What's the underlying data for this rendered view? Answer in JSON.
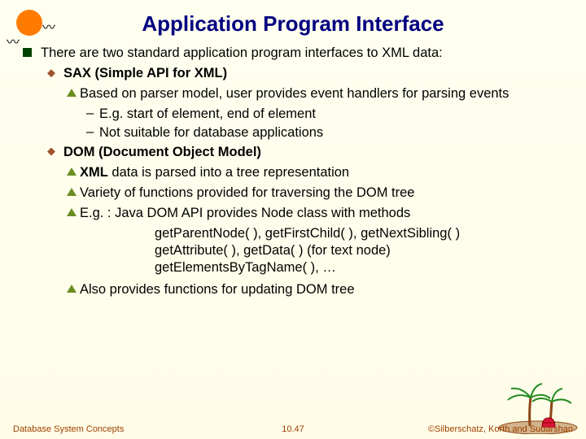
{
  "title": "Application Program Interface",
  "l1_intro": "There are two standard application program interfaces to XML data:",
  "sax": {
    "heading": "SAX (Simple API for XML)",
    "detail": "Based on parser model, user provides event handlers for parsing events",
    "sub1": "E.g. start of element, end of element",
    "sub2": "Not suitable for database applications"
  },
  "dom": {
    "heading": "DOM (Document Object Model)",
    "d1_bold": "XML",
    "d1_rest": " data is parsed into a tree representation",
    "d2": "Variety of functions provided for traversing the DOM tree",
    "d3": "E.g. :  Java DOM API provides Node class with methods",
    "d3a": "getParentNode( ), getFirstChild( ), getNextSibling( )",
    "d3b": "getAttribute( ), getData( ) (for text node)",
    "d3c": "getElementsByTagName( ), …",
    "d4": "Also provides functions for updating DOM tree"
  },
  "footer": {
    "left": "Database System Concepts",
    "center": "10.47",
    "right": "©Silberschatz, Korth and Sudarshan"
  }
}
